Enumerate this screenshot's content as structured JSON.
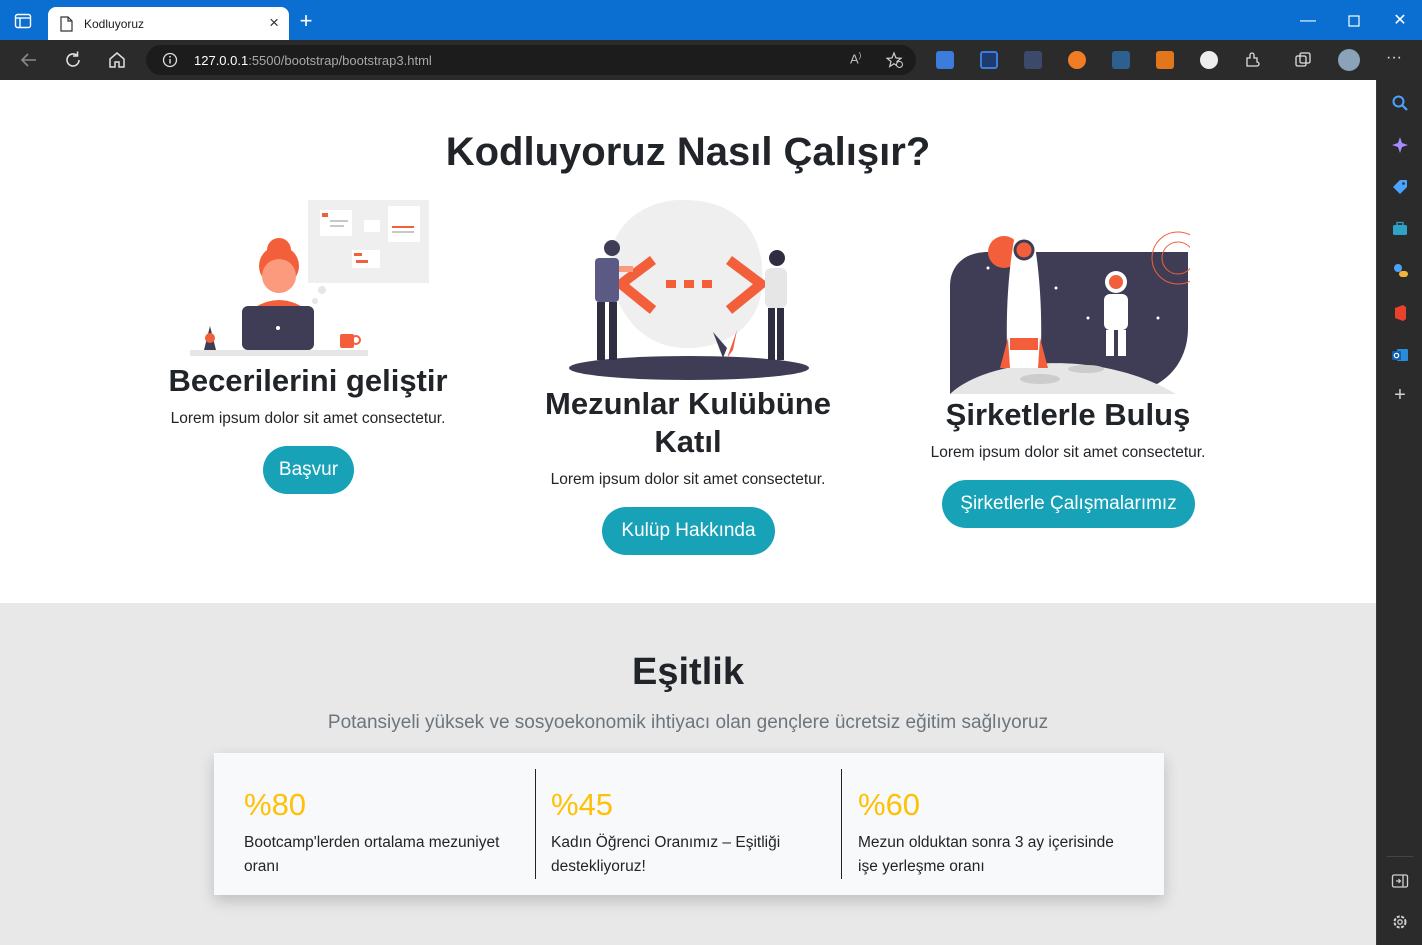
{
  "browser": {
    "tab_title": "Kodluyoruz",
    "url_host": "127.0.0.1",
    "url_rest": ":5500/bootstrap/bootstrap3.html"
  },
  "page": {
    "heading": "Kodluyoruz Nasıl Çalışır?",
    "columns": [
      {
        "title": "Becerilerini geliştir",
        "text": "Lorem ipsum dolor sit amet consectetur.",
        "button": "Başvur",
        "illustration": "developer-at-laptop-illustration"
      },
      {
        "title_line1": "Mezunlar Kulübüne",
        "title_line2": "Katıl",
        "text": "Lorem ipsum dolor sit amet consectetur.",
        "button": "Kulüp Hakkında",
        "illustration": "code-collaboration-illustration"
      },
      {
        "title": "Şirketlerle Buluş",
        "text": "Lorem ipsum dolor sit amet consectetur.",
        "button": "Şirketlerle Çalışmalarımız",
        "illustration": "rocket-astronaut-illustration"
      }
    ],
    "equality": {
      "heading": "Eşitlik",
      "subtitle": "Potansiyeli yüksek ve sosyoekonomik ihtiyacı olan gençlere ücretsiz eğitim sağlıyoruz",
      "stats": [
        {
          "value": "%80",
          "label": "Bootcamp'lerden ortalama mezuniyet oranı"
        },
        {
          "value": "%45",
          "label": "Kadın Öğrenci Oranımız – Eşitliği destekliyoruz!"
        },
        {
          "value": "%60",
          "label": "Mezun olduktan sonra 3 ay içerisinde işe yerleşme oranı"
        }
      ]
    }
  },
  "colors": {
    "button": "#17a2b8",
    "stat_value": "#ffc107",
    "accent_illustration": "#f25f3a",
    "titlebar": "#0a6fd0"
  }
}
